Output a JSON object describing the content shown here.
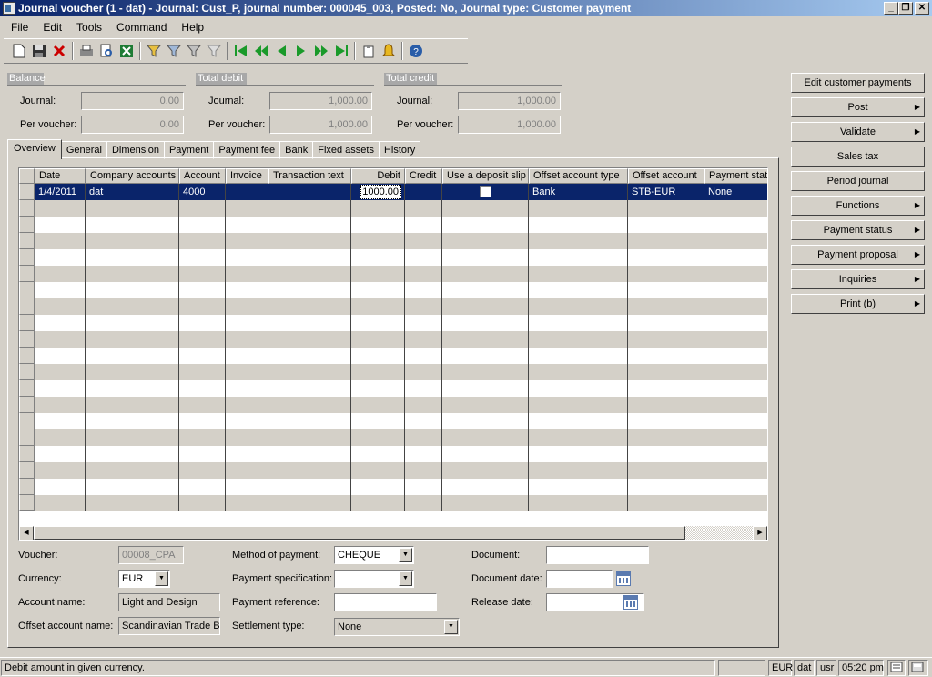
{
  "window": {
    "title": "Journal voucher (1 - dat) - Journal: Cust_P, journal number: 000045_003, Posted: No, Journal type: Customer payment",
    "minimize": "_",
    "restore": "❐",
    "close": "✕"
  },
  "menu": [
    "File",
    "Edit",
    "Tools",
    "Command",
    "Help"
  ],
  "totals": {
    "balance": {
      "title": "Balance",
      "journal_label": "Journal:",
      "journal": "0.00",
      "voucher_label": "Per voucher:",
      "voucher": "0.00"
    },
    "debit": {
      "title": "Total debit",
      "journal_label": "Journal:",
      "journal": "1,000.00",
      "voucher_label": "Per voucher:",
      "voucher": "1,000.00"
    },
    "credit": {
      "title": "Total credit",
      "journal_label": "Journal:",
      "journal": "1,000.00",
      "voucher_label": "Per voucher:",
      "voucher": "1,000.00"
    }
  },
  "tabs": [
    "Overview",
    "General",
    "Dimension",
    "Payment",
    "Payment fee",
    "Bank",
    "Fixed assets",
    "History"
  ],
  "grid": {
    "columns": [
      "Date",
      "Company accounts",
      "Account",
      "Invoice",
      "Transaction text",
      "Debit",
      "Credit",
      "Use a deposit slip",
      "Offset account type",
      "Offset account",
      "Payment stat"
    ],
    "rows": [
      [
        "1/4/2011",
        "dat",
        "4000",
        "",
        "",
        "1000.00",
        "",
        "",
        "Bank",
        "STB-EUR",
        "None"
      ]
    ]
  },
  "form": {
    "voucher_label": "Voucher:",
    "voucher": "00008_CPA",
    "currency_label": "Currency:",
    "currency": "EUR",
    "account_name_label": "Account name:",
    "account_name": "Light and Design",
    "offset_name_label": "Offset account name:",
    "offset_name": "Scandinavian Trade B",
    "method_label": "Method of payment:",
    "method": "CHEQUE",
    "spec_label": "Payment specification:",
    "spec": "",
    "ref_label": "Payment reference:",
    "ref": "",
    "settle_label": "Settlement type:",
    "settle": "None",
    "document_label": "Document:",
    "document": "",
    "docdate_label": "Document date:",
    "docdate": "",
    "release_label": "Release date:",
    "release": ""
  },
  "actions": [
    {
      "label": "Edit customer payments",
      "arrow": false
    },
    {
      "label": "Post",
      "arrow": true
    },
    {
      "label": "Validate",
      "arrow": true
    },
    {
      "label": "Sales tax",
      "arrow": false
    },
    {
      "label": "Period journal",
      "arrow": false
    },
    {
      "label": "Functions",
      "arrow": true
    },
    {
      "label": "Payment status",
      "arrow": true
    },
    {
      "label": "Payment proposal",
      "arrow": true
    },
    {
      "label": "Inquiries",
      "arrow": true
    },
    {
      "label": "Print (b)",
      "arrow": true
    }
  ],
  "status": {
    "message": "Debit amount in given currency.",
    "currency": "EUR",
    "company": "dat",
    "user": "usr",
    "time": "05:20 pm"
  },
  "icons": [
    "new-icon",
    "save-icon",
    "delete-icon",
    "print-icon",
    "print-preview-icon",
    "excel-icon",
    "filter-selection-icon",
    "filter-form-icon",
    "advanced-filter-icon",
    "remove-filter-icon",
    "first-record-icon",
    "previous-page-icon",
    "previous-record-icon",
    "next-record-icon",
    "next-page-icon",
    "last-record-icon",
    "document-handling-icon",
    "alert-icon",
    "help-icon"
  ]
}
